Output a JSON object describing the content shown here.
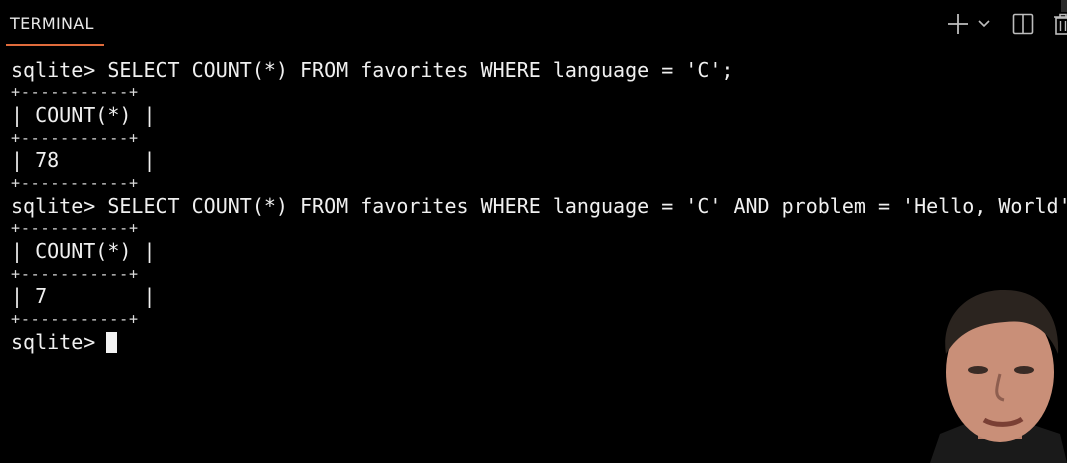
{
  "panel": {
    "tab_label": "TERMINAL",
    "accent_color": "#e06c3c",
    "icons": [
      "plus-icon",
      "chevron-down-icon",
      "split-icon",
      "trash-icon"
    ]
  },
  "terminal": {
    "prompt": "sqlite> ",
    "lines": {
      "cmd1": "sqlite> SELECT COUNT(*) FROM favorites WHERE language = 'C';",
      "border1a": "+-----------+",
      "header1": "| COUNT(*) |",
      "border1b": "+-----------+",
      "row1": "| 78       |",
      "border1c": "+-----------+",
      "cmd2": "sqlite> SELECT COUNT(*) FROM favorites WHERE language = 'C' AND problem = 'Hello, World';",
      "border2a": "+-----------+",
      "header2": "| COUNT(*) |",
      "border2b": "+-----------+",
      "row2": "| 7        |",
      "border2c": "+-----------+",
      "prompt_line": "sqlite> "
    }
  }
}
